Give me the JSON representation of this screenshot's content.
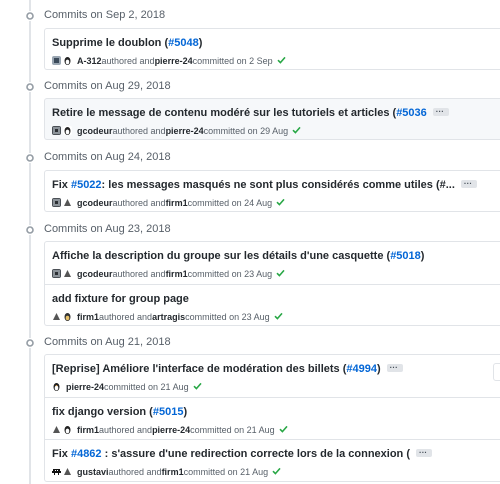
{
  "colors": {
    "link": "#0366d6",
    "check": "#28a745",
    "muted": "#586069"
  },
  "days": [
    {
      "title": "Commits on Sep 2, 2018",
      "commits": [
        {
          "pre": "Supprime le doublon (",
          "pr": "#5048",
          "post": ")",
          "author": "A-312",
          "authored": " authored and ",
          "committer": "pierre-24",
          "committed": " committed on 2 Sep"
        }
      ]
    },
    {
      "title": "Commits on Aug 29, 2018",
      "commits": [
        {
          "pre": "Retire le message de contenu modéré sur les tutoriels et articles (",
          "pr": "#5036",
          "post": "",
          "ellipsis": "...",
          "author": "gcodeur",
          "authored": " authored and ",
          "committer": "pierre-24",
          "committed": " committed on 29 Aug"
        }
      ]
    },
    {
      "title": "Commits on Aug 24, 2018",
      "commits": [
        {
          "pre": "Fix ",
          "pr": "#5022",
          "post": ": les messages masqués ne sont plus considérés comme utiles (#...",
          "ellipsis": "...",
          "author": "gcodeur",
          "authored": " authored and ",
          "committer": "firm1",
          "committed": " committed on 24 Aug"
        }
      ]
    },
    {
      "title": "Commits on Aug 23, 2018",
      "commits": [
        {
          "pre": "Affiche la description du groupe sur les détails d'une casquette (",
          "pr": "#5018",
          "post": ")",
          "author": "gcodeur",
          "authored": " authored and ",
          "committer": "firm1",
          "committed": " committed on 23 Aug"
        },
        {
          "pre": "add fixture for group page",
          "pr": "",
          "post": "",
          "author": "firm1",
          "authored": " authored and ",
          "committer": "artragis",
          "committed": " committed on 23 Aug"
        }
      ]
    },
    {
      "title": "Commits on Aug 21, 2018",
      "commits": [
        {
          "pre": "[Reprise] Améliore l'interface de modération des billets (",
          "pr": "#4994",
          "post": ")",
          "ellipsis": "...",
          "author": "",
          "authored": "",
          "committer": "pierre-24",
          "committed": " committed on 21 Aug"
        },
        {
          "pre": "fix django version (",
          "pr": "#5015",
          "post": ")",
          "author": "firm1",
          "authored": " authored and ",
          "committer": "pierre-24",
          "committed": " committed on 21 Aug"
        },
        {
          "pre": "Fix ",
          "pr": "#4862",
          "post": " : s'assure d'une redirection correcte lors de la connexion (",
          "ellipsis": "...",
          "author": "gustavi",
          "authored": " authored and ",
          "committer": "firm1",
          "committed": " committed on 21 Aug"
        }
      ]
    }
  ]
}
